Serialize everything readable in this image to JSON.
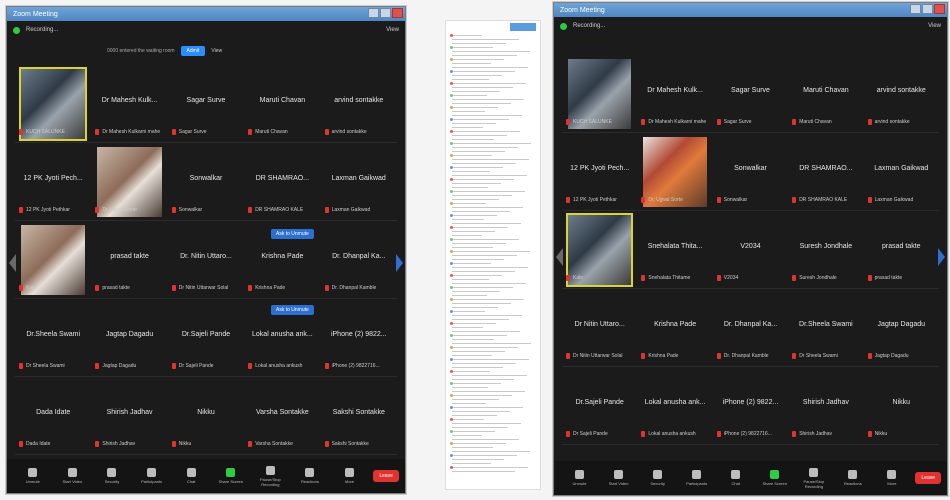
{
  "left": {
    "title": "Zoom Meeting",
    "recording": "Recording...",
    "view": "View",
    "notice": {
      "text": "0000 entered the waiting room",
      "admit": "Admit",
      "view": "View"
    },
    "rows": [
      [
        {
          "big": "",
          "small": "KUCH SALUNKE",
          "video": true,
          "vclass": "",
          "active": true
        },
        {
          "big": "Dr Mahesh Kulk...",
          "small": "Dr Mahesh Kulkarni mahe"
        },
        {
          "big": "Sagar Surve",
          "small": "Sagar Surve"
        },
        {
          "big": "Maruti Chavan",
          "small": "Maruti Chavan"
        },
        {
          "big": "arvind sontakke",
          "small": "arvind sontakke"
        }
      ],
      [
        {
          "big": "12 PK Jyoti Pech...",
          "small": "12 PK Jyoti Pethkar"
        },
        {
          "big": "",
          "small": "Dr. Ujjwal Sorte",
          "video": true,
          "vclass": "warm"
        },
        {
          "big": "Sonwalkar",
          "small": "Sonwalkar"
        },
        {
          "big": "DR SHAMRAO...",
          "small": "DR SHAMRAO KALE"
        },
        {
          "big": "Laxman Gaikwad",
          "small": "Laxman Gaikwad"
        }
      ],
      [
        {
          "big": "",
          "small": "Kale",
          "video": true,
          "vclass": "warm"
        },
        {
          "big": "prasad takte",
          "small": "prasad takte"
        },
        {
          "big": "Dr. Nitin Uttaro...",
          "small": "Dr Nitin Uttarwar Solal"
        },
        {
          "big": "Krishna Pade",
          "small": "Krishna Pade"
        },
        {
          "big": "Dr. Dhanpal Ka...",
          "small": "Dr. Dhanpal Kamble"
        }
      ],
      [
        {
          "big": "Dr.Sheela Swami",
          "small": "Dr Sheela Swami"
        },
        {
          "big": "Jagtap Dagadu",
          "small": "Jagtap Dagadu"
        },
        {
          "big": "Dr.Sajeli Pande",
          "small": "Dr Sajeli Pande"
        },
        {
          "big": "Lokal anusha ank...",
          "small": "Lokal anusha ankush"
        },
        {
          "big": "iPhone (2) 9822...",
          "small": "iPhone (2) 9822716..."
        }
      ],
      [
        {
          "big": "Dada Idate",
          "small": "Dada Idate"
        },
        {
          "big": "Shirish Jadhav",
          "small": "Shirish Jadhav"
        },
        {
          "big": "Nikku",
          "small": "Nikku"
        },
        {
          "big": "Varsha Sontakke",
          "small": "Varsha Sontakke"
        },
        {
          "big": "Sakshi Sontakke",
          "small": "Sakshi Sontakke"
        }
      ]
    ],
    "pill1": "Ask to Unmute",
    "pill2": "Ask to Unmute",
    "toolbar": [
      "Unmute",
      "Start Video",
      "Security",
      "Participants",
      "Chat",
      "Share Screen",
      "Pause/Stop Recording",
      "Reactions",
      "More"
    ],
    "leave": "Leave"
  },
  "right": {
    "title": "Zoom Meeting",
    "recording": "Recording...",
    "view": "View",
    "rows": [
      [
        {
          "big": "",
          "small": "KUCH SALUNKE",
          "video": true,
          "vclass": ""
        },
        {
          "big": "Dr Mahesh Kulk...",
          "small": "Dr Mahesh Kulkarni mahe"
        },
        {
          "big": "Sagar Surve",
          "small": "Sagar Surve"
        },
        {
          "big": "Maruti Chavan",
          "small": "Maruti Chavan"
        },
        {
          "big": "arvind sontakke",
          "small": "arvind sontakke"
        }
      ],
      [
        {
          "big": "12 PK Jyoti Pech...",
          "small": "12 PK Jyoti Pethkar"
        },
        {
          "big": "",
          "small": "Dr. Ujjwal Sorte",
          "video": true,
          "vclass": "red"
        },
        {
          "big": "Sonwalkar",
          "small": "Sonwalkar"
        },
        {
          "big": "DR SHAMRAO...",
          "small": "DR SHAMRAO KALE"
        },
        {
          "big": "Laxman Gaikwad",
          "small": "Laxman Gaikwad"
        }
      ],
      [
        {
          "big": "",
          "small": "Kale",
          "video": true,
          "vclass": "",
          "active": true
        },
        {
          "big": "Snehalata Thita...",
          "small": "Snehalata Thitame"
        },
        {
          "big": "V2034",
          "small": "V2034"
        },
        {
          "big": "Suresh Jondhale",
          "small": "Suresh Jondhale"
        },
        {
          "big": "prasad takte",
          "small": "prasad takte"
        }
      ],
      [
        {
          "big": "Dr Nitin Uttaro...",
          "small": "Dr Nitin Uttarwar Solal"
        },
        {
          "big": "Krishna Pade",
          "small": "Krishna Pade"
        },
        {
          "big": "Dr. Dhanpal Ka...",
          "small": "Dr. Dhanpal Kamble"
        },
        {
          "big": "Dr.Sheela Swami",
          "small": "Dr Sheela Swami"
        },
        {
          "big": "Jagtap Dagadu",
          "small": "Jagtap Dagadu"
        }
      ],
      [
        {
          "big": "Dr.Sajeli Pande",
          "small": "Dr Sajeli Pande"
        },
        {
          "big": "Lokal anusha ank...",
          "small": "Lokal anusha ankush"
        },
        {
          "big": "iPhone (2) 9822...",
          "small": "iPhone (2) 9822716..."
        },
        {
          "big": "Shirish Jadhav",
          "small": "Shirish Jadhav"
        },
        {
          "big": "Nikku",
          "small": "Nikku"
        }
      ]
    ],
    "toolbar": [
      "Unmute",
      "Start Video",
      "Security",
      "Participants",
      "Chat",
      "Share Screen",
      "Pause/Stop Recording",
      "Reactions",
      "More"
    ],
    "leave": "Leave"
  },
  "colors": {
    "accent": "#2d8cff",
    "muted_mic": "#e0322e",
    "active_speaker": "#d9d42e",
    "leave": "#e0322e"
  }
}
